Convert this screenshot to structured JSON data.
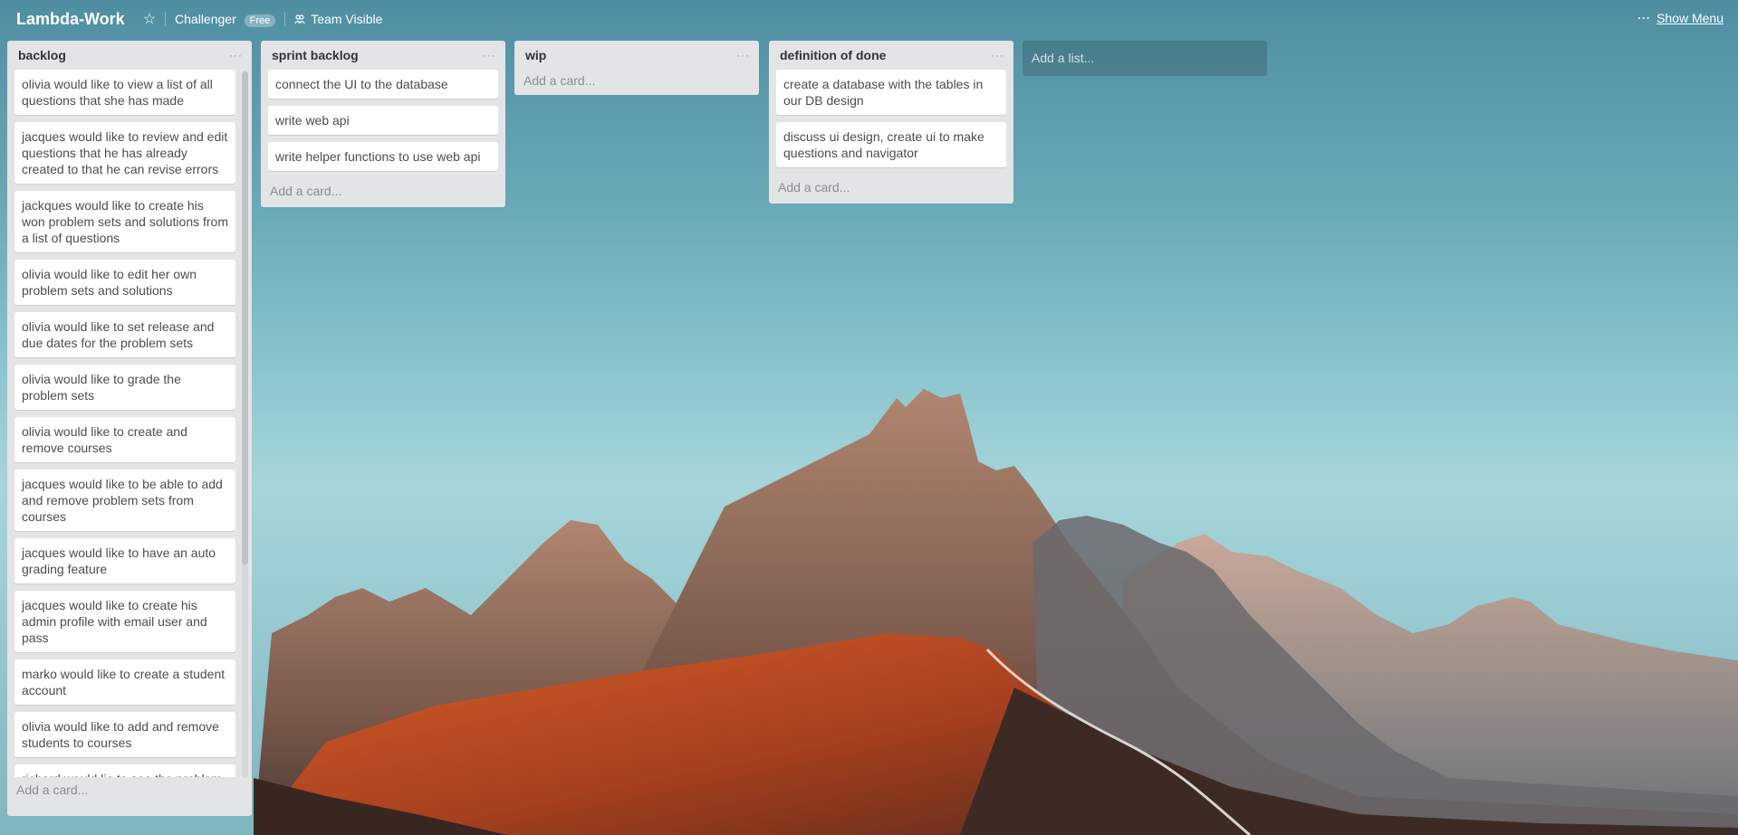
{
  "header": {
    "board_title": "Lambda-Work",
    "star_icon": "star-icon",
    "org_name": "Challenger",
    "org_badge": "Free",
    "visibility": "Team Visible",
    "visibility_icon": "team-icon",
    "menu_dots": "···",
    "show_menu": "Show Menu"
  },
  "lists": {
    "backlog": {
      "title": "backlog",
      "menu": "···",
      "cards": [
        "olivia would like to view a list of all questions that she has made",
        "jacques would like to review and edit questions that he has already created to that he can revise errors",
        "jackques would like to create his won problem sets and solutions from a list of questions",
        "olivia would like to edit her own problem sets and solutions",
        "olivia would like to set release and due dates for the problem sets",
        "olivia would like to grade the problem sets",
        "olivia would like to create and remove courses",
        "jacques would like to be able to add and remove problem sets from courses",
        "jacques would like to have an auto grading feature",
        "jacques would like to create his admin profile with email user and pass",
        "marko would like to create a student account",
        "olivia would like to add and remove students to courses",
        "richard would lie to see the problem sets for the courses he's in"
      ],
      "add_card": "Add a card..."
    },
    "sprint": {
      "title": "sprint backlog",
      "menu": "···",
      "cards": [
        "connect the UI to the database",
        "write web api",
        "write helper functions to use web api"
      ],
      "add_card": "Add a card..."
    },
    "wip": {
      "title": "wip",
      "menu": "···",
      "cards": [],
      "add_card": "Add a card..."
    },
    "done": {
      "title": "definition of done",
      "menu": "···",
      "cards": [
        "create a database with the tables in our DB design",
        "discuss ui design, create ui to make questions and navigator"
      ],
      "add_card": "Add a card..."
    }
  },
  "add_list": "Add a list...",
  "colors": {
    "list_bg": "#e2e4e6",
    "card_bg": "#ffffff",
    "sky_top": "#4f8ea2",
    "sky_mid": "#a6d5da",
    "mountain_rock": "#8a6a5a",
    "mountain_lit": "#c4582e"
  }
}
